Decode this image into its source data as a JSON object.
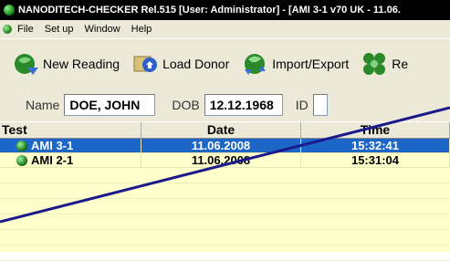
{
  "title_bar": {
    "text": "NANODITECH-CHECKER Rel.515  [User: Administrator]  - [AMI 3-1 v70 UK - 11.06."
  },
  "menu": {
    "items": [
      "File",
      "Set up",
      "Window",
      "Help"
    ]
  },
  "toolbar": {
    "buttons": [
      {
        "label": "New Reading",
        "icon": "new-reading-icon"
      },
      {
        "label": "Load Donor",
        "icon": "load-donor-icon"
      },
      {
        "label": "Import/Export",
        "icon": "import-export-icon"
      },
      {
        "label": "Re",
        "icon": "report-icon"
      }
    ]
  },
  "patient": {
    "name_label": "Name",
    "name_value": "DOE, JOHN",
    "dob_label": "DOB",
    "dob_value": "12.12.1968",
    "id_label": "ID",
    "id_value": ""
  },
  "table": {
    "columns": [
      "Test",
      "Date",
      "Time"
    ],
    "rows": [
      {
        "test": "AMI 3-1",
        "date": "11.06.2008",
        "time": "15:32:41",
        "selected": true
      },
      {
        "test": "AMI 2-1",
        "date": "11.06.2008",
        "time": "15:31:04",
        "selected": false
      }
    ]
  },
  "colors": {
    "title_bg": "#000000",
    "chrome_bg": "#ece9d8",
    "grid_bg": "#ffffcc",
    "selected_row": "#1c66c8",
    "overlay_line": "#1a1a8c"
  }
}
